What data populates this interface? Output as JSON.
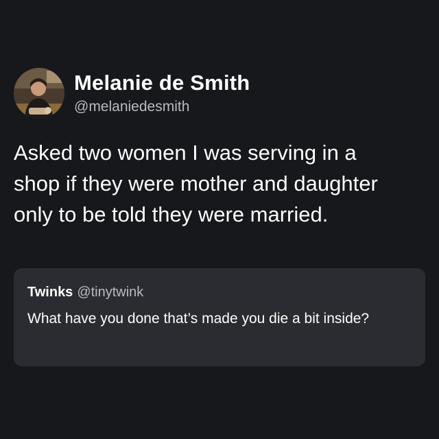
{
  "tweet": {
    "author": {
      "display_name": "Melanie de Smith",
      "handle": "@melaniedesmith",
      "avatar_icon": "profile-photo"
    },
    "text": "Asked two women I was serving in a shop if they were mother and daughter only to be told they were married."
  },
  "quoted_tweet": {
    "author": {
      "display_name": "Twinks",
      "handle": "@tinytwink"
    },
    "text": "What have you done that’s made you die a bit inside?"
  },
  "colors": {
    "background": "#16181c",
    "quote_background": "#2a2c31",
    "primary_text": "#ffffff",
    "secondary_text": "#b8bcc2"
  }
}
